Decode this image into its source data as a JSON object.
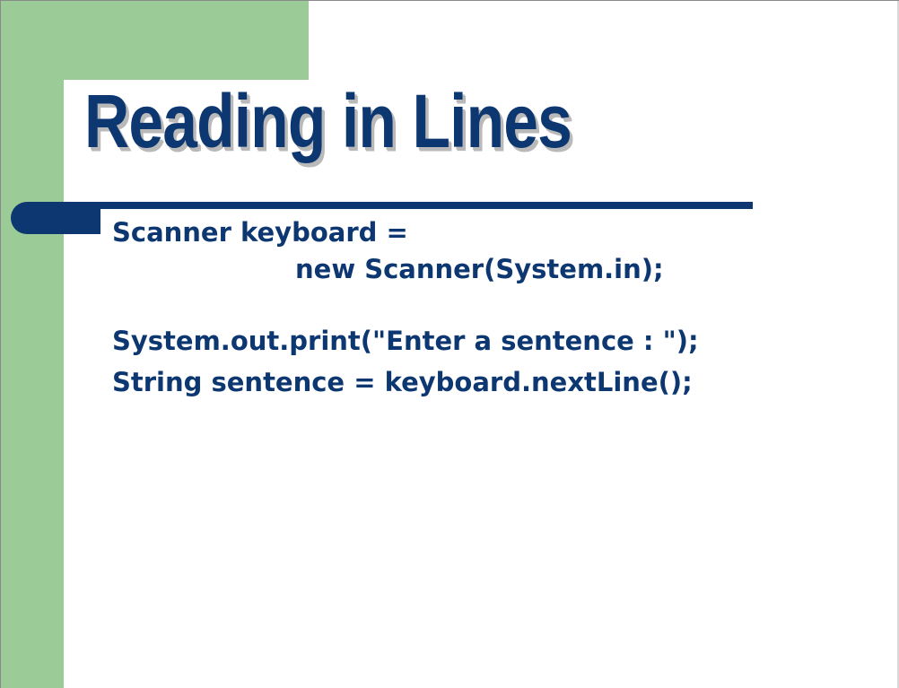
{
  "slide": {
    "title": "Reading in Lines",
    "code_lines": [
      "Scanner keyboard =",
      "new Scanner(System.in);",
      "System.out.print(\"Enter a sentence : \");",
      "String sentence = keyboard.nextLine();"
    ]
  },
  "colors": {
    "accent_green": "#9bcb96",
    "text_navy": "#0d3770",
    "title_shadow": "#b9b9b9",
    "background": "#ffffff"
  }
}
